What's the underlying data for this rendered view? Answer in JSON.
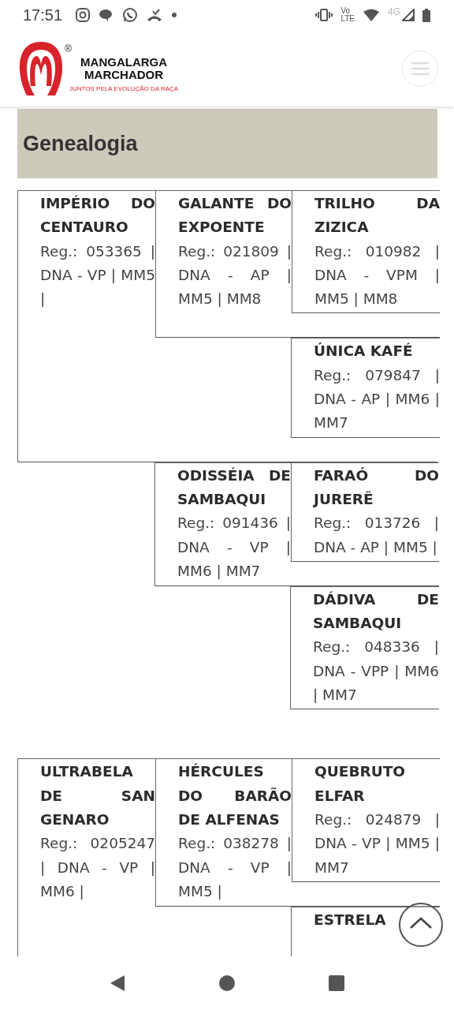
{
  "status_bar": {
    "time": "17:51",
    "volte_top": "Vo",
    "volte_bottom": "LTE",
    "network": "4G"
  },
  "header": {
    "brand_line_1": "MANGALARGA",
    "brand_line_2": "MARCHADOR",
    "registered_mark": "®",
    "tagline": "JUNTOS PELA EVOLUÇÃO DA RAÇA"
  },
  "section_title": "Genealogia",
  "pedigrees": [
    {
      "name": "IMPÉRIO DO CENTAURO",
      "info": "Reg.: 053365 | DNA - VP | MM5 |",
      "parents": [
        {
          "name": "GALANTE DO EXPOENTE",
          "info": "Reg.: 021809 | DNA - AP | MM5 | MM8",
          "parents": [
            {
              "name": "TRILHO DA ZIZICA",
              "info": "Reg.: 010982 | DNA - VPM | MM5 | MM8"
            },
            {
              "name": "ÚNICA KAFÉ",
              "info": "Reg.: 079847 | DNA - AP | MM6 | MM7"
            }
          ]
        },
        {
          "name": "ODISSÉIA DE SAMBAQUI",
          "info": "Reg.: 091436 | DNA - VP | MM6 | MM7",
          "parents": [
            {
              "name": "FARAÓ DO JURERÊ",
              "info": "Reg.: 013726 | DNA - AP | MM5 |"
            },
            {
              "name": "DÁDIVA DE SAMBAQUI",
              "info": "Reg.: 048336 | DNA - VPP | MM6 | MM7"
            }
          ]
        }
      ]
    },
    {
      "name": "ULTRABELA DE SAN GENARO",
      "info": "Reg.: 0205247 | DNA - VP | MM6 |",
      "parents": [
        {
          "name": "HÉRCULES DO BARÃO DE ALFENAS",
          "info": "Reg.: 038278 | DNA - VP | MM5 |",
          "parents": [
            {
              "name": "QUEBRUTO ELFAR",
              "info": "Reg.: 024879 | DNA - VP | MM5 | MM7"
            },
            {
              "name": "ESTRELA"
            }
          ]
        }
      ]
    }
  ]
}
